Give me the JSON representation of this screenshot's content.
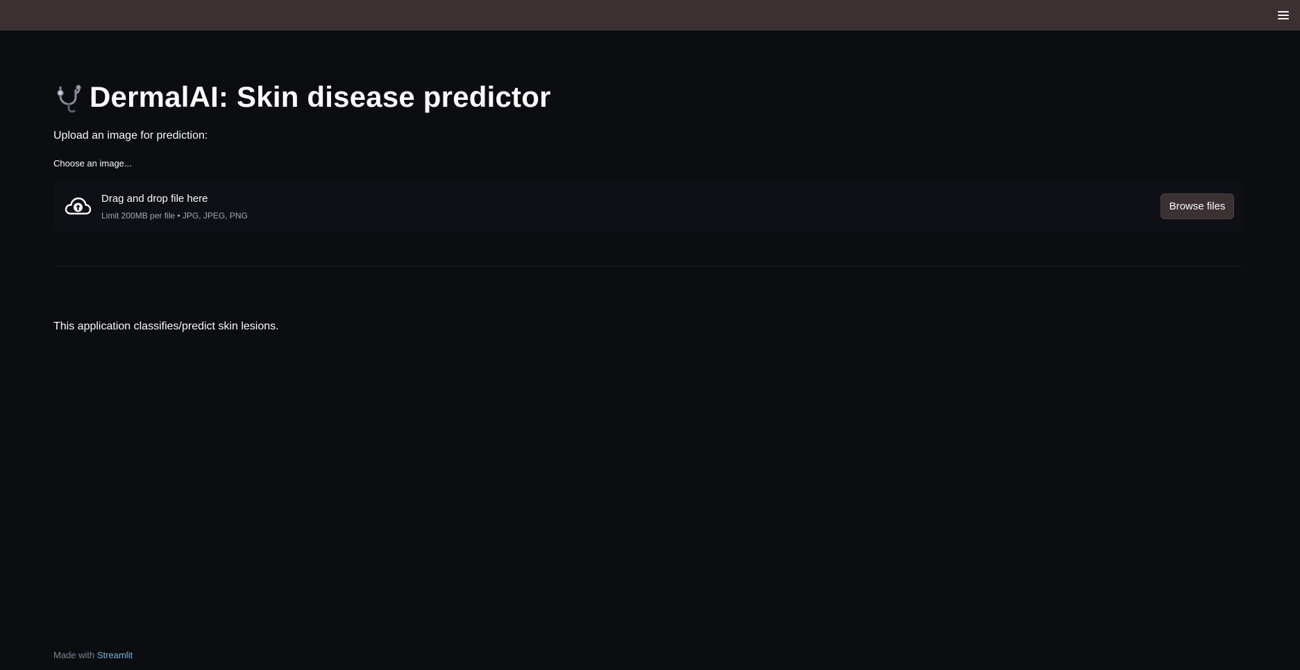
{
  "header": {
    "menu_icon": "hamburger-menu-icon"
  },
  "main": {
    "title_icon": "stethoscope-icon",
    "title": "DermalAI: Skin disease predictor",
    "subtitle": "Upload an image for prediction:",
    "uploader": {
      "label": "Choose an image...",
      "icon": "cloud-upload-icon",
      "drop_text": "Drag and drop file here",
      "limit_text": "Limit 200MB per file • JPG, JPEG, PNG",
      "browse_label": "Browse files"
    },
    "description": "This application classifies/predict skin lesions."
  },
  "footer": {
    "prefix": "Made with",
    "link_text": "Streamlit"
  },
  "colors": {
    "background": "#0b0d11",
    "topbar": "#3b3133",
    "button": "#3b3133",
    "link": "#7ab3e0"
  }
}
